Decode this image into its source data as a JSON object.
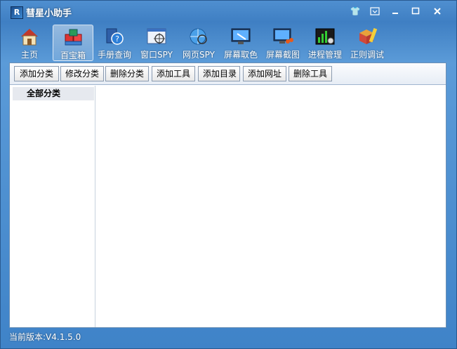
{
  "window": {
    "title": "彗星小助手",
    "logo_text": "R"
  },
  "window_controls": [
    "skin-icon",
    "menu-icon",
    "minimize-icon",
    "maximize-icon",
    "close-icon"
  ],
  "nav_tabs": [
    {
      "label": "主页",
      "icon": "home-icon"
    },
    {
      "label": "百宝箱",
      "icon": "toolbox-icon",
      "active": true
    },
    {
      "label": "手册查询",
      "icon": "help-book-icon"
    },
    {
      "label": "窗口SPY",
      "icon": "window-spy-icon"
    },
    {
      "label": "网页SPY",
      "icon": "web-spy-icon"
    },
    {
      "label": "屏幕取色",
      "icon": "color-picker-icon"
    },
    {
      "label": "屏幕截图",
      "icon": "screenshot-icon"
    },
    {
      "label": "进程管理",
      "icon": "process-manager-icon"
    },
    {
      "label": "正则调试",
      "icon": "regex-debug-icon"
    }
  ],
  "command_buttons": [
    "添加分类",
    "修改分类",
    "删除分类",
    "添加工具",
    "添加目录",
    "添加网址",
    "删除工具"
  ],
  "sidebar": {
    "category": "全部分类"
  },
  "status": {
    "version": "当前版本:V4.1.5.0"
  },
  "colors": {
    "window_blue": "#3f83c8",
    "selected_category_bg": "#e6e9ef"
  }
}
